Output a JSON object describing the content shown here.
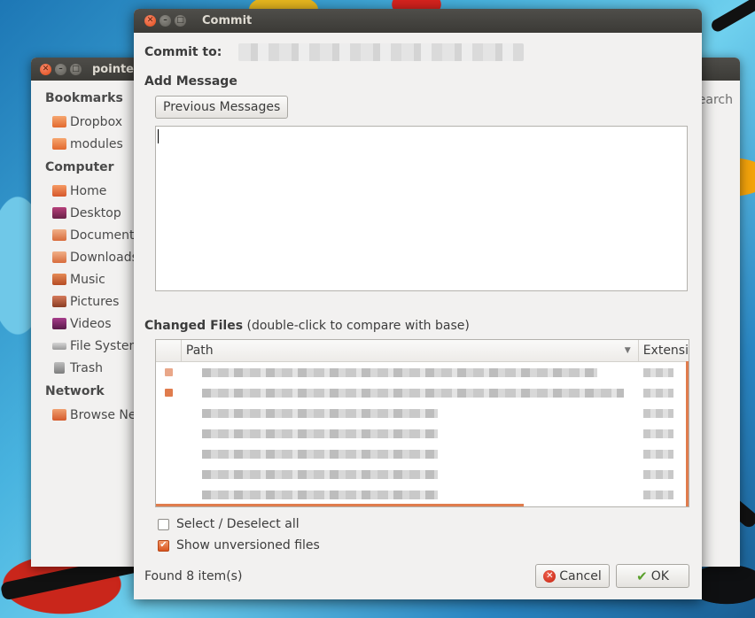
{
  "file_manager": {
    "title": "pointe",
    "search_text": "earch",
    "sidebar": {
      "bookmarks_header": "Bookmarks",
      "bookmarks": [
        {
          "label": "Dropbox",
          "icon": "folder-icon"
        },
        {
          "label": "modules",
          "icon": "folder-icon"
        }
      ],
      "computer_header": "Computer",
      "computer": [
        {
          "label": "Home",
          "icon": "home-icon"
        },
        {
          "label": "Desktop",
          "icon": "desktop-icon"
        },
        {
          "label": "Documents",
          "icon": "documents-icon"
        },
        {
          "label": "Downloads",
          "icon": "downloads-icon"
        },
        {
          "label": "Music",
          "icon": "music-icon"
        },
        {
          "label": "Pictures",
          "icon": "pictures-icon"
        },
        {
          "label": "Videos",
          "icon": "videos-icon"
        },
        {
          "label": "File System",
          "icon": "file-system-icon"
        },
        {
          "label": "Trash",
          "icon": "trash-icon"
        }
      ],
      "network_header": "Network",
      "network": [
        {
          "label": "Browse Ne",
          "icon": "network-folder-icon"
        }
      ]
    }
  },
  "dialog": {
    "title": "Commit",
    "commit_to_label": "Commit to:",
    "add_message_label": "Add Message",
    "previous_messages_button": "Previous Messages",
    "message_value": "",
    "changed_files_label": "Changed Files",
    "changed_files_hint": " (double-click to compare with base)",
    "columns": {
      "path": "Path",
      "extension": "Extensi"
    },
    "rows": [
      {
        "marked": true,
        "mark_color": "#e9a789"
      },
      {
        "marked": true,
        "mark_color": "#e07c4d"
      },
      {
        "marked": false
      },
      {
        "marked": false
      },
      {
        "marked": false
      },
      {
        "marked": false
      },
      {
        "marked": false
      },
      {
        "marked": false
      }
    ],
    "select_all_label": "Select / Deselect all",
    "select_all_checked": false,
    "show_unversioned_label": "Show unversioned files",
    "show_unversioned_checked": true,
    "status_text": "Found 8 item(s)",
    "cancel_button": "Cancel",
    "ok_button": "OK"
  },
  "colors": {
    "accent": "#e07c4d",
    "titlebar": "#3c3b37",
    "window_bg": "#f2f1f0"
  }
}
